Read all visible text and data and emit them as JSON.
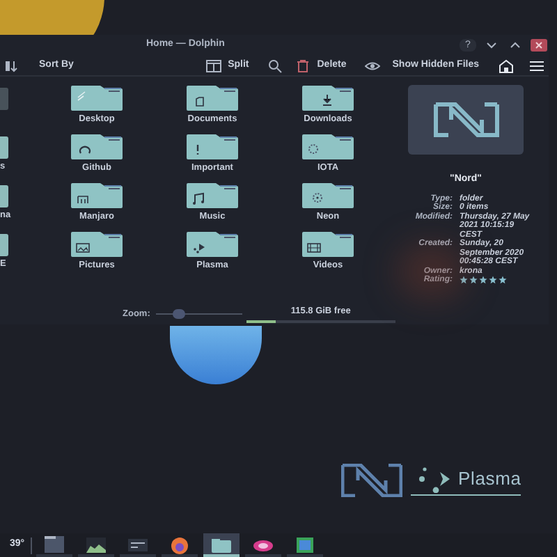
{
  "window": {
    "title": "Home — Dolphin",
    "help": "?"
  },
  "toolbar": [
    {
      "kind": "sort",
      "label": "Sort By"
    },
    {
      "kind": "split",
      "label": "Split"
    },
    {
      "kind": "search"
    },
    {
      "kind": "delete",
      "label": "Delete"
    },
    {
      "kind": "hidden",
      "label": "Show Hidden Files"
    },
    {
      "kind": "home"
    },
    {
      "kind": "menu"
    }
  ],
  "files": [
    {
      "kind": "partial"
    },
    {
      "kind": "desktop",
      "name": "Desktop"
    },
    {
      "kind": "documents",
      "name": "Documents"
    },
    {
      "kind": "downloads",
      "name": "Downloads"
    },
    {
      "kind": "partial",
      "name": "s"
    },
    {
      "kind": "github",
      "name": "Github"
    },
    {
      "kind": "important",
      "name": "Important"
    },
    {
      "kind": "iota",
      "name": "IOTA"
    },
    {
      "kind": "partial",
      "name": "na"
    },
    {
      "kind": "manjaro",
      "name": "Manjaro"
    },
    {
      "kind": "music",
      "name": "Music"
    },
    {
      "kind": "neon",
      "name": "Neon"
    },
    {
      "kind": "partial",
      "name": "E"
    },
    {
      "kind": "pictures",
      "name": "Pictures"
    },
    {
      "kind": "plasma",
      "name": "Plasma"
    },
    {
      "kind": "videos",
      "name": "Videos"
    }
  ],
  "info": {
    "title": "\"Nord\"",
    "properties": [
      {
        "label": "Type:",
        "value": "folder"
      },
      {
        "label": "Size:",
        "value": "0 items"
      },
      {
        "label": "Modified:",
        "value": "Thursday, 27 May 2021 10:15:19 CEST"
      },
      {
        "label": "Created:",
        "value": "Sunday, 20 September 2020 00:45:28 CEST"
      },
      {
        "label": "Owner:",
        "value": "krona"
      }
    ],
    "rating_label": "Rating:",
    "stars": 5
  },
  "status_bar": {
    "zoom_label": "Zoom:",
    "zoom": {
      "level": 0.27
    },
    "free_space": "115.8 GiB free",
    "space": {
      "level": 0.2
    }
  },
  "desktop": {
    "logo_text": "Plasma"
  },
  "taskbar": {
    "temperature": "39°",
    "tasks": [
      {
        "kind": "desktop",
        "selected": false
      },
      {
        "kind": "monitor",
        "selected": false
      },
      {
        "kind": "terminal",
        "selected": false
      },
      {
        "kind": "browser",
        "selected": false
      },
      {
        "kind": "files",
        "selected": true
      },
      {
        "kind": "eye",
        "selected": false
      },
      {
        "kind": "store",
        "selected": false
      }
    ]
  }
}
